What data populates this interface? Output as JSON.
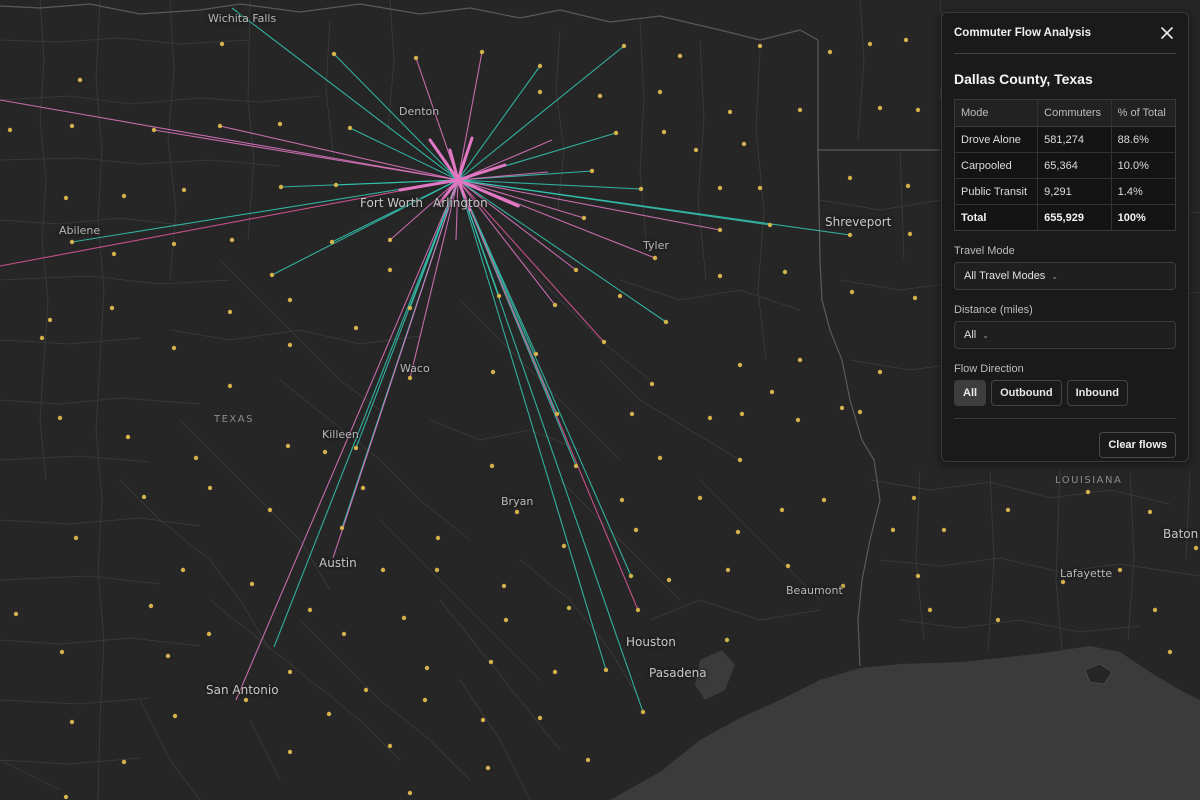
{
  "panel": {
    "title": "Commuter Flow Analysis",
    "close_icon": "close-icon",
    "county": "Dallas County, Texas",
    "table": {
      "headers": [
        "Mode",
        "Commuters",
        "% of Total"
      ],
      "rows": [
        {
          "mode": "Drove Alone",
          "commuters": "581,274",
          "pct": "88.6%"
        },
        {
          "mode": "Carpooled",
          "commuters": "65,364",
          "pct": "10.0%"
        },
        {
          "mode": "Public Transit",
          "commuters": "9,291",
          "pct": "1.4%"
        }
      ],
      "total": {
        "mode": "Total",
        "commuters": "655,929",
        "pct": "100%"
      }
    },
    "travel_mode": {
      "label": "Travel Mode",
      "value": "All Travel Modes"
    },
    "distance": {
      "label": "Distance (miles)",
      "value": "All"
    },
    "flow_direction": {
      "label": "Flow Direction",
      "options": [
        "All",
        "Outbound",
        "Inbound"
      ],
      "selected": "All"
    },
    "clear_label": "Clear flows"
  },
  "map": {
    "cities": [
      "Wichita Falls",
      "Denton",
      "Fort Worth",
      "Arlington",
      "Abilene",
      "Shreveport",
      "Tyler",
      "Waco",
      "Killeen",
      "Bryan",
      "Austin",
      "Beaumont",
      "Houston",
      "Pasadena",
      "San Antonio",
      "Lafayette",
      "Baton R"
    ],
    "states": [
      "TEXAS",
      "LOUISIANA"
    ],
    "colors": {
      "background": "#262626",
      "county_line": "#3c3c3c",
      "state_line": "#5a5a5a",
      "water": "#3b3b3b",
      "centroid": "#d4b24c",
      "flow_teal": "#35c9b5",
      "flow_pink": "#e278c4",
      "flow_rose": "#e2589a"
    }
  }
}
